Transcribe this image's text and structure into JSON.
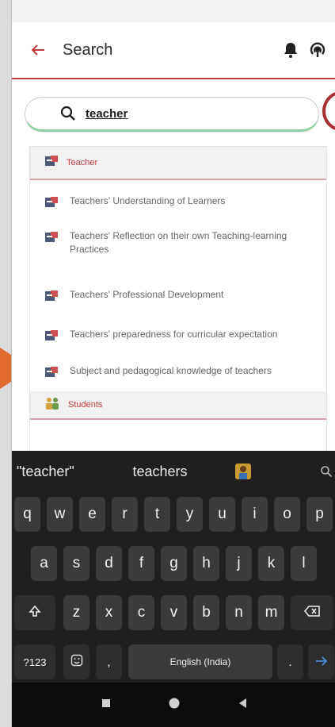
{
  "appbar": {
    "title": "Search"
  },
  "search": {
    "query": "teacher"
  },
  "results": {
    "group_teacher": "Teacher",
    "items": [
      "Teachers' Understanding of Learners",
      "Teachers' Reflection on their own Teaching-learning Practices",
      "Teachers' Professional Development",
      "Teachers' preparedness for curricular expectation",
      "Subject and pedagogical knowledge of teachers"
    ],
    "group_students": "Students"
  },
  "keyboard": {
    "suggestions": [
      "\"teacher\"",
      "teachers"
    ],
    "row1": [
      "q",
      "w",
      "e",
      "r",
      "t",
      "y",
      "u",
      "i",
      "o",
      "p"
    ],
    "row2": [
      "a",
      "s",
      "d",
      "f",
      "g",
      "h",
      "j",
      "k",
      "l"
    ],
    "row3": [
      "z",
      "x",
      "c",
      "v",
      "b",
      "n",
      "m"
    ],
    "sym_label": "?123",
    "comma": ",",
    "space_label": "English (India)",
    "period": "."
  },
  "colors": {
    "accent": "#c2393e",
    "arrow": "#e06a2c",
    "keyboard_bg": "#1f1f1f",
    "key_bg": "#3b3b3b"
  },
  "icons": [
    "back-arrow-icon",
    "bell-icon",
    "broadcast-icon",
    "search-icon",
    "document-icon",
    "students-icon",
    "emoji-icon",
    "backspace-icon",
    "shift-icon",
    "enter-icon"
  ]
}
